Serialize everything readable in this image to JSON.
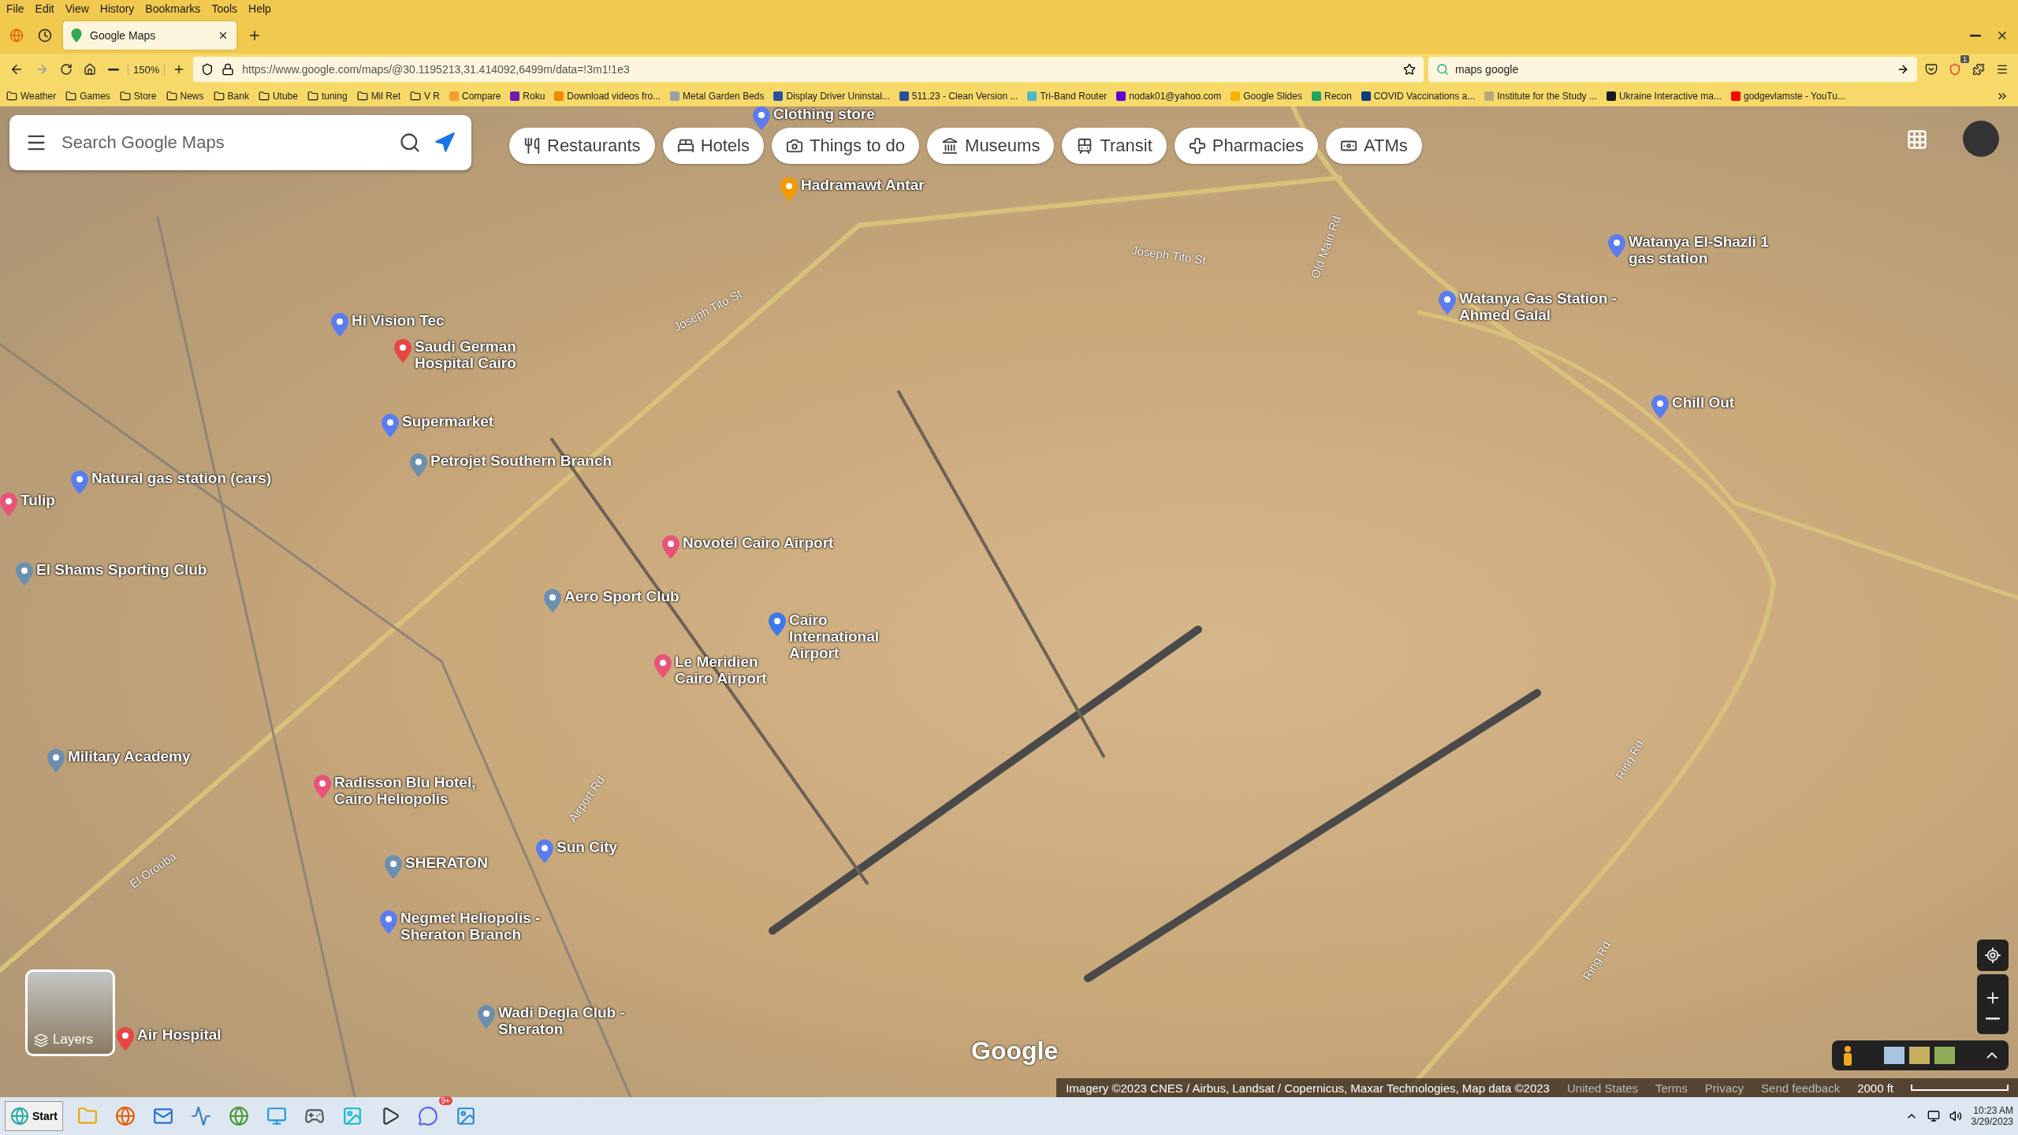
{
  "browser": {
    "menu": [
      "File",
      "Edit",
      "View",
      "History",
      "Bookmarks",
      "Tools",
      "Help"
    ],
    "tab": {
      "title": "Google Maps"
    },
    "zoom": "150%",
    "url": "https://www.google.com/maps/@30.1195213,31.414092,6499m/data=!3m1!1e3",
    "search": "maps google",
    "extension_badge": "1",
    "bookmarks": [
      {
        "kind": "folder",
        "label": "Weather"
      },
      {
        "kind": "folder",
        "label": "Games"
      },
      {
        "kind": "folder",
        "label": "Store"
      },
      {
        "kind": "folder",
        "label": "News"
      },
      {
        "kind": "folder",
        "label": "Bank"
      },
      {
        "kind": "folder",
        "label": "Utube"
      },
      {
        "kind": "folder",
        "label": "tuning"
      },
      {
        "kind": "folder",
        "label": "Mil Ret"
      },
      {
        "kind": "folder",
        "label": "V R"
      },
      {
        "kind": "link",
        "label": "Compare",
        "color": "#f0a030"
      },
      {
        "kind": "link",
        "label": "Roku",
        "color": "#6f1ab1"
      },
      {
        "kind": "link",
        "label": "Download videos fro...",
        "color": "#f08a00"
      },
      {
        "kind": "link",
        "label": "Metal Garden Beds",
        "color": "#9aa0a6"
      },
      {
        "kind": "link",
        "label": "Display Driver Uninstal...",
        "color": "#2a4fa0"
      },
      {
        "kind": "link",
        "label": "511.23 - Clean Version ...",
        "color": "#2a4fa0"
      },
      {
        "kind": "link",
        "label": "Tri-Band Router",
        "color": "#4bb8c8"
      },
      {
        "kind": "link",
        "label": "nodak01@yahoo.com",
        "color": "#6001d2"
      },
      {
        "kind": "link",
        "label": "Google Slides",
        "color": "#f4b400"
      },
      {
        "kind": "link",
        "label": "Recon",
        "color": "#1fa463"
      },
      {
        "kind": "link",
        "label": "COVID Vaccinations a...",
        "color": "#0b3c7d"
      },
      {
        "kind": "link",
        "label": "Institute for the Study ...",
        "color": "#b8a878"
      },
      {
        "kind": "link",
        "label": "Ukraine Interactive ma...",
        "color": "#1a1a1a"
      },
      {
        "kind": "link",
        "label": "godgevlamste - YouTu...",
        "color": "#ff0000"
      }
    ]
  },
  "map": {
    "search": {
      "placeholder": "Search Google Maps"
    },
    "chips": [
      "Restaurants",
      "Hotels",
      "Things to do",
      "Museums",
      "Transit",
      "Pharmacies",
      "ATMs"
    ],
    "places": [
      {
        "name": "Clothing store",
        "color": "#5b7cf0"
      },
      {
        "name": "Hadramawt Antar",
        "color": "#f29900"
      },
      {
        "name": "Hi Vision Tec",
        "color": "#5b7cf0"
      },
      {
        "name": "Saudi German Hospital Cairo",
        "color": "#e84545"
      },
      {
        "name": "Supermarket",
        "color": "#5b7cf0"
      },
      {
        "name": "Petrojet Southern Branch",
        "color": "#6b8fae"
      },
      {
        "name": "Natural gas station (cars)",
        "color": "#5b7cf0"
      },
      {
        "name": "Tulip",
        "color": "#e8537a"
      },
      {
        "name": "El Shams Sporting Club",
        "color": "#6b8fae"
      },
      {
        "name": "Novotel Cairo Airport",
        "color": "#e8537a"
      },
      {
        "name": "Aero Sport Club",
        "color": "#6b8fae"
      },
      {
        "name": "Cairo International Airport",
        "color": "#3b78e7"
      },
      {
        "name": "Le Meridien Cairo Airport",
        "color": "#e8537a"
      },
      {
        "name": "Military Academy",
        "color": "#6b8fae"
      },
      {
        "name": "Radisson Blu Hotel, Cairo Heliopolis",
        "color": "#e8537a"
      },
      {
        "name": "SHERATON",
        "color": "#6b8fae"
      },
      {
        "name": "Sun City",
        "color": "#5b7cf0"
      },
      {
        "name": "Negmet Heliopolis - Sheraton Branch",
        "color": "#5b7cf0"
      },
      {
        "name": "Air Hospital",
        "color": "#e84545"
      },
      {
        "name": "Wadi Degla Club - Sheraton",
        "color": "#6b8fae"
      },
      {
        "name": "Watanya El-Shazli 1 gas station",
        "color": "#5b7cf0"
      },
      {
        "name": "Watanya Gas Station - Ahmed Galal",
        "color": "#5b7cf0"
      },
      {
        "name": "Chill Out",
        "color": "#5b7cf0"
      }
    ],
    "roads": [
      "Joseph Tito St",
      "Joseph Tito St",
      "Old Main Rd",
      "Airport Rd",
      "Ring Rd",
      "Ring Rd",
      "El Orouba"
    ],
    "logo": "Google",
    "layers": "Layers",
    "attribution": "Imagery ©2023 CNES / Airbus, Landsat / Copernicus, Maxar Technologies, Map data ©2023",
    "links": [
      "United States",
      "Terms",
      "Privacy",
      "Send feedback"
    ],
    "scale": "2000 ft"
  },
  "taskbar": {
    "start": "Start",
    "badge": "9+",
    "time": "10:23 AM",
    "date": "3/29/2023"
  }
}
